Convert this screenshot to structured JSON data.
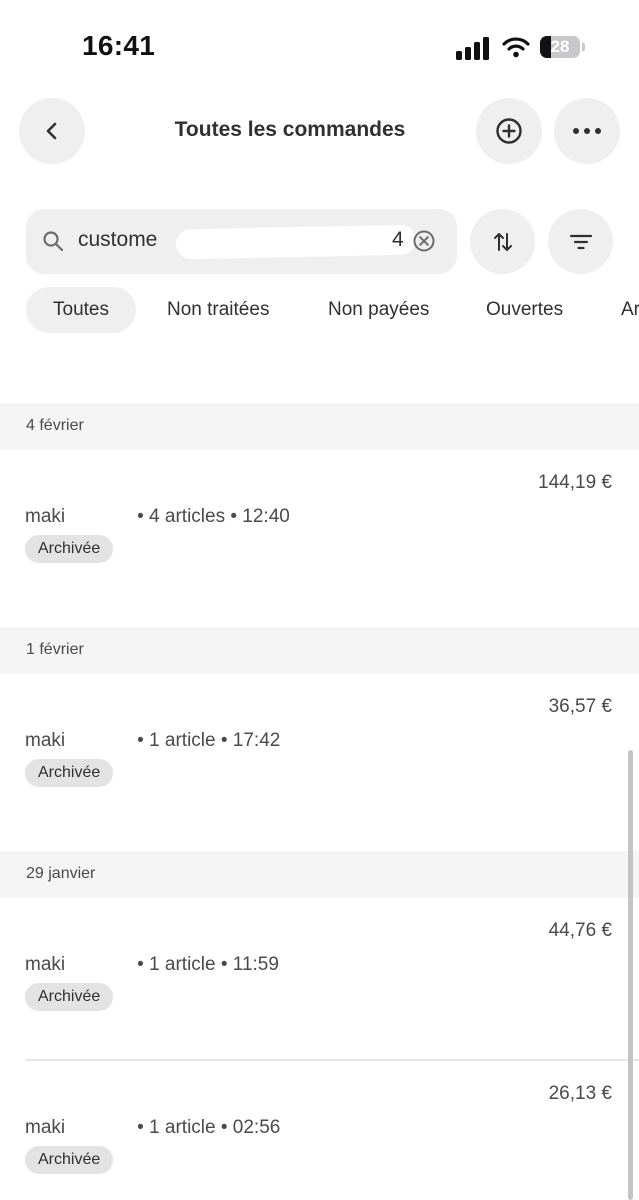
{
  "status_bar": {
    "time": "16:41",
    "battery": "28",
    "battery_level": 0.28,
    "icons": [
      "signal-icon",
      "wifi-icon",
      "battery-icon"
    ]
  },
  "header": {
    "title": "Toutes les commandes",
    "back_icon": "chevron-left-icon",
    "add_icon": "plus-circle-icon",
    "more_icon": "ellipsis-icon"
  },
  "search": {
    "value_start": "custome",
    "value_end": "4",
    "clear_icon": "clear-icon",
    "sort_icon": "sort-arrows-icon",
    "filter_icon": "filter-lines-icon"
  },
  "tabs": [
    {
      "label": "Toutes",
      "active": true
    },
    {
      "label": "Non traitées",
      "active": false
    },
    {
      "label": "Non payées",
      "active": false
    },
    {
      "label": "Ouvertes",
      "active": false
    },
    {
      "label": "Ar",
      "active": false
    }
  ],
  "sections": [
    {
      "date": "4 février",
      "orders": [
        {
          "customer": "maki",
          "details": "• 4 articles • 12:40",
          "amount": "144,19 €",
          "status": "Archivée"
        }
      ]
    },
    {
      "date": "1 février",
      "orders": [
        {
          "customer": "maki",
          "details": "• 1 article • 17:42",
          "amount": "36,57 €",
          "status": "Archivée"
        }
      ]
    },
    {
      "date": "29 janvier",
      "orders": [
        {
          "customer": "maki",
          "details": "• 1 article • 11:59",
          "amount": "44,76 €",
          "status": "Archivée"
        },
        {
          "customer": "maki",
          "details": "• 1 article • 02:56",
          "amount": "26,13 €",
          "status": "Archivée"
        }
      ]
    }
  ],
  "colors": {
    "background": "#ffffff",
    "button_bg": "#efefef",
    "section_bg": "#f5f5f5",
    "badge_bg": "#e3e3e3",
    "text": "#303030"
  }
}
